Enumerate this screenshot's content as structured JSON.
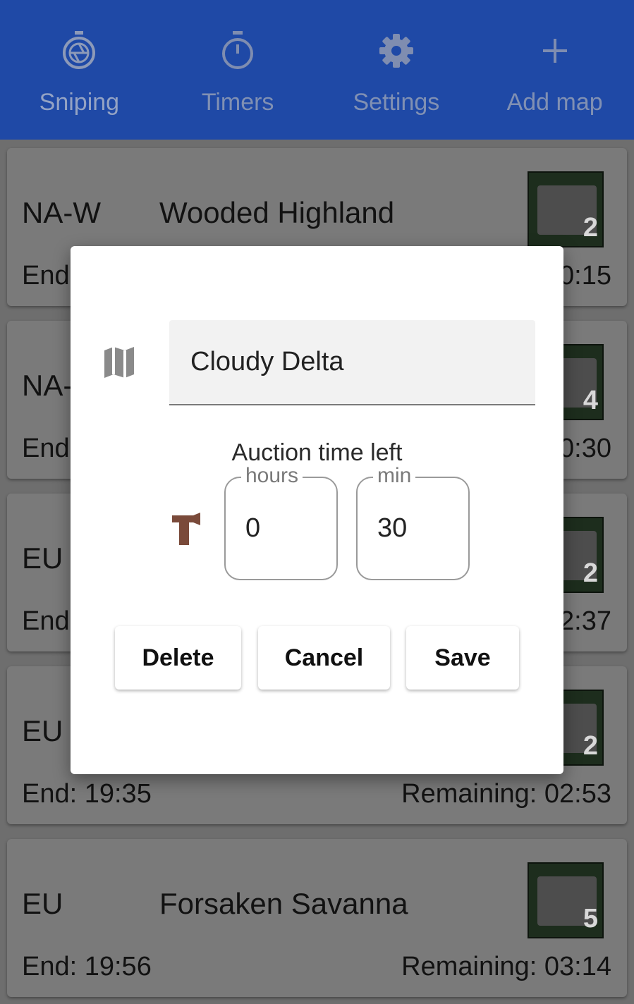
{
  "tabs": [
    {
      "label": "Sniping",
      "icon": "camera-shutter-icon"
    },
    {
      "label": "Timers",
      "icon": "stopwatch-icon"
    },
    {
      "label": "Settings",
      "icon": "gear-icon"
    },
    {
      "label": "Add map",
      "icon": "plus-icon"
    }
  ],
  "cards": [
    {
      "region": "NA-W",
      "map": "Wooded Highland",
      "end": "End",
      "remaining": "0:15",
      "count": "2"
    },
    {
      "region": "NA-",
      "map": "",
      "end": "End",
      "remaining": "0:30",
      "count": "4"
    },
    {
      "region": "EU",
      "map": "",
      "end": "End",
      "remaining": "2:37",
      "count": "2"
    },
    {
      "region": "EU",
      "map": "",
      "end": "End: 19:35",
      "remaining": "Remaining: 02:53",
      "count": "2"
    },
    {
      "region": "EU",
      "map": "Forsaken Savanna",
      "end": "End: 19:56",
      "remaining": "Remaining: 03:14",
      "count": "5"
    }
  ],
  "dialog": {
    "map_name": "Cloudy Delta",
    "auction_title": "Auction time left",
    "hours_label": "hours",
    "hours_value": "0",
    "min_label": "min",
    "min_value": "30",
    "delete_label": "Delete",
    "cancel_label": "Cancel",
    "save_label": "Save"
  },
  "colors": {
    "appbar": "#1f49a6",
    "hammer": "#7a4a3a",
    "map_icon": "#8a8a8a"
  }
}
